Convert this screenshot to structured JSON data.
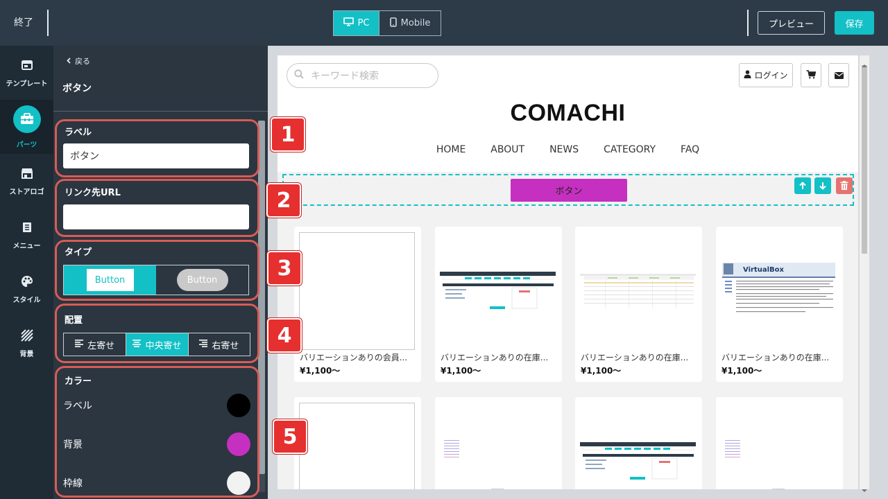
{
  "topbar": {
    "exit_label": "終了",
    "device_pc": "PC",
    "device_mobile": "Mobile",
    "preview_label": "プレビュー",
    "save_label": "保存"
  },
  "rail": {
    "items": [
      {
        "label": "テンプレート",
        "icon": "template-icon"
      },
      {
        "label": "パーツ",
        "icon": "toolbox-icon",
        "active": true
      },
      {
        "label": "ストアロゴ",
        "icon": "store-icon"
      },
      {
        "label": "メニュー",
        "icon": "menu-list-icon"
      },
      {
        "label": "スタイル",
        "icon": "palette-icon"
      },
      {
        "label": "背景",
        "icon": "background-pattern-icon"
      }
    ]
  },
  "panel": {
    "back_label": "戻る",
    "title": "ボタン",
    "label_section": {
      "title": "ラベル",
      "value": "ボタン"
    },
    "link_section": {
      "title": "リンク先URL",
      "value": ""
    },
    "type_section": {
      "title": "タイプ",
      "option_square": "Button",
      "option_rounded": "Button"
    },
    "align_section": {
      "title": "配置",
      "left": "左寄せ",
      "center": "中央寄せ",
      "right": "右寄せ",
      "selected": "center"
    },
    "color_section": {
      "title": "カラー",
      "rows": [
        {
          "label": "ラベル",
          "color": "#000000"
        },
        {
          "label": "背景",
          "color": "#c530c0"
        },
        {
          "label": "枠線",
          "color": "#f2f2f2"
        }
      ]
    }
  },
  "badges": [
    "1",
    "2",
    "3",
    "4",
    "5"
  ],
  "site": {
    "search_placeholder": "キーワード検索",
    "login_label": "ログイン",
    "brand": "COMACHI",
    "nav": [
      "HOME",
      "ABOUT",
      "NEWS",
      "CATEGORY",
      "FAQ"
    ],
    "button_label": "ボタン",
    "products": [
      {
        "name": "バリエーションありの会員...",
        "price": "¥1,100〜",
        "image": "broken"
      },
      {
        "name": "バリエーションありの在庫...",
        "price": "¥1,100〜",
        "image": "admin-screenshot"
      },
      {
        "name": "バリエーションありの在庫...",
        "price": "¥1,100〜",
        "image": "calendar-screenshot"
      },
      {
        "name": "バリエーションありの在庫...",
        "price": "¥1,100〜",
        "image": "virtualbox-screenshot"
      }
    ],
    "virtualbox_text": "VirtualBox"
  },
  "colors": {
    "accent": "#12c0c6",
    "topbar": "#2d3b48",
    "badge": "#e5302f",
    "section_border": "#d85c56",
    "button_bg": "#c530c0",
    "delete": "#e5736f"
  }
}
